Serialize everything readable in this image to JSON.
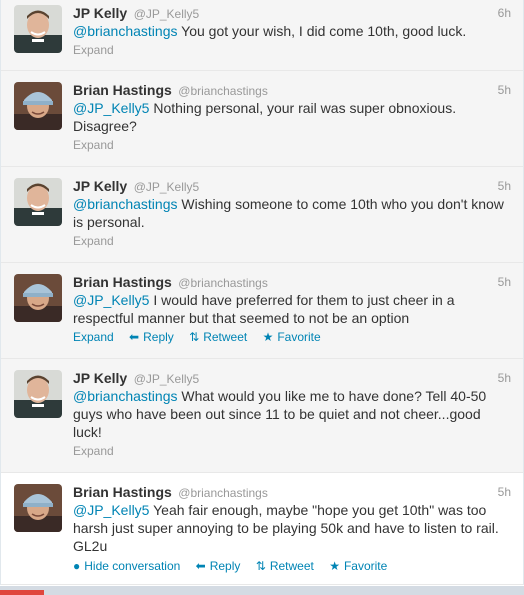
{
  "tweets": [
    {
      "fullname": "JP Kelly",
      "username": "@JP_Kelly5",
      "time": "6h",
      "mention": "@brianchastings",
      "text": " You got your wish, I did come 10th, good luck.",
      "expand": "Expand"
    },
    {
      "fullname": "Brian Hastings",
      "username": "@brianchastings",
      "time": "5h",
      "mention": "@JP_Kelly5",
      "text": " Nothing personal, your rail was super obnoxious. Disagree?",
      "expand": "Expand"
    },
    {
      "fullname": "JP Kelly",
      "username": "@JP_Kelly5",
      "time": "5h",
      "mention": "@brianchastings",
      "text": " Wishing someone to come 10th who you don't know is personal.",
      "expand": "Expand"
    },
    {
      "fullname": "Brian Hastings",
      "username": "@brianchastings",
      "time": "5h",
      "mention": "@JP_Kelly5",
      "text": " I would have preferred for them to just cheer in a respectful manner but that seemed to not be an option",
      "expand": "Expand",
      "reply": "Reply",
      "retweet": "Retweet",
      "favorite": "Favorite"
    },
    {
      "fullname": "JP Kelly",
      "username": "@JP_Kelly5",
      "time": "5h",
      "mention": "@brianchastings",
      "text": " What would you like me to have done? Tell 40-50 guys who have been out since 11 to be quiet and not cheer...good luck!",
      "expand": "Expand"
    },
    {
      "fullname": "Brian Hastings",
      "username": "@brianchastings",
      "time": "5h",
      "mention": "@JP_Kelly5",
      "text": " Yeah fair enough, maybe \"hope you get 10th\" was too harsh just super annoying to be playing 50k and have to listen to rail. GL2u",
      "hide": "Hide conversation",
      "reply": "Reply",
      "retweet": "Retweet",
      "favorite": "Favorite"
    }
  ],
  "icons": {
    "reply": "reply-arrow-icon",
    "retweet": "retweet-icon",
    "favorite": "star-icon",
    "conversation": "speech-bubble-icon"
  },
  "colors": {
    "link": "#0084b4",
    "muted": "#999999",
    "text": "#333333",
    "tweet_bg": "#f5f5f5"
  }
}
